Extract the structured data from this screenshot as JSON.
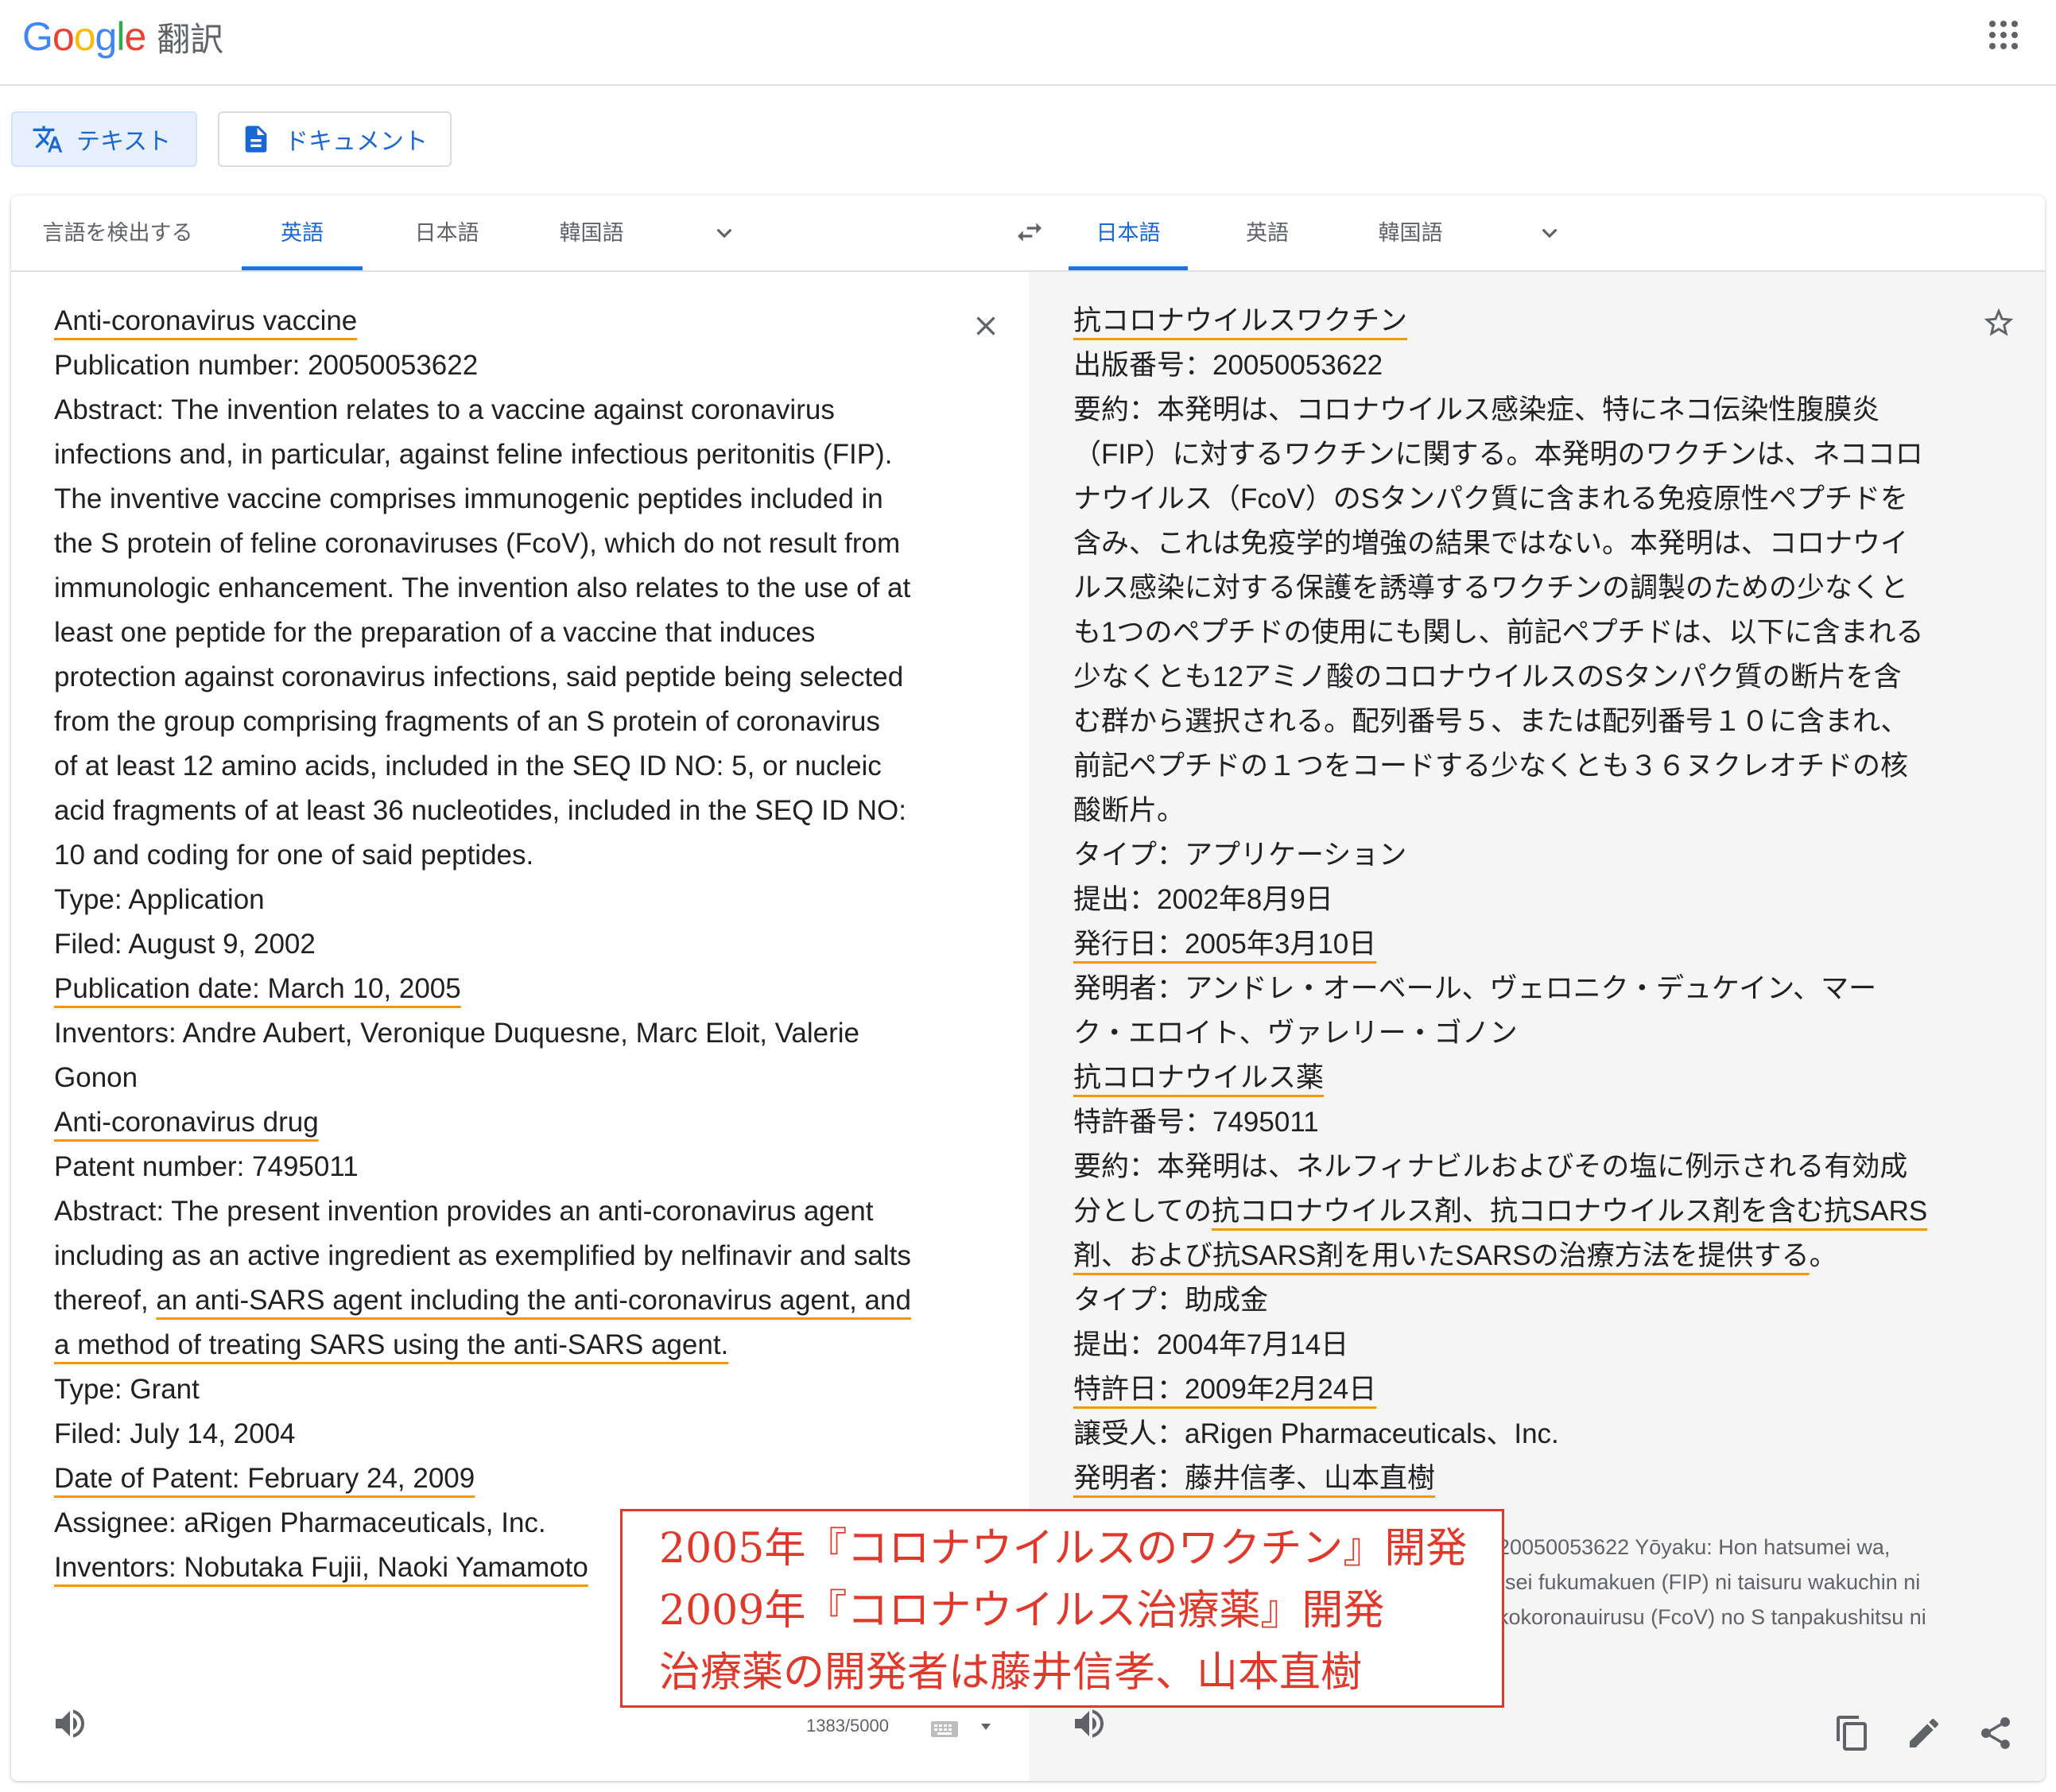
{
  "header": {
    "logo_text": "Google",
    "product": "翻訳",
    "apps_icon": "apps-grid-icon"
  },
  "modes": [
    {
      "label": "テキスト",
      "icon": "translate-icon",
      "active": true
    },
    {
      "label": "ドキュメント",
      "icon": "document-icon",
      "active": false
    }
  ],
  "source_tabs": [
    "言語を検出する",
    "英語",
    "日本語",
    "韓国語"
  ],
  "target_tabs": [
    "日本語",
    "英語",
    "韓国語"
  ],
  "colors": {
    "accent": "#1a73e8",
    "underline": "#f29900",
    "annotation": "#e0392b"
  },
  "source": {
    "lines": [
      "Anti-coronavirus vaccine",
      "Publication number: 20050053622",
      "Abstract: The invention relates to a vaccine against coronavirus",
      "infections and, in particular, against feline infectious peritonitis (FIP).",
      "The inventive vaccine comprises immunogenic peptides included in",
      "the S protein of feline coronaviruses (FcoV), which do not result from",
      "immunologic enhancement. The invention also relates to the use of at",
      "least one peptide for the preparation of a vaccine that induces",
      "protection against coronavirus infections, said peptide being selected",
      "from the group comprising fragments of an S protein of coronavirus",
      "of at least 12 amino acids, included in the SEQ ID NO: 5, or nucleic",
      "acid fragments of at least 36 nucleotides, included in the SEQ ID NO:",
      "10 and coding for one of said peptides.",
      "Type: Application",
      "Filed: August 9, 2002",
      "Publication date: March 10, 2005",
      "Inventors: Andre Aubert, Veronique Duquesne, Marc Eloit, Valerie",
      "Gonon",
      "Anti-coronavirus drug",
      "Patent number: 7495011",
      "Abstract: The present invention provides an anti-coronavirus agent",
      "including as an active ingredient as exemplified by nelfinavir and salts",
      "thereof, ",
      "an anti-SARS agent including the anti-coronavirus agent, and",
      "a method of treating SARS using the anti-SARS agent.",
      "Type: Grant",
      "Filed: July 14, 2004",
      "Date of Patent: February 24, 2009",
      "Assignee: aRigen Pharmaceuticals, Inc.",
      "Inventors: Nobutaka Fujii, Naoki Yamamoto"
    ],
    "char_count": "1383/5000"
  },
  "target": {
    "lines": [
      "抗コロナウイルスワクチン",
      "出版番号：20050053622",
      "要約：本発明は、コロナウイルス感染症、特にネコ伝染性腹膜炎",
      "（FIP）に対するワクチンに関する。本発明のワクチンは、ネココロ",
      "ナウイルス（FcoV）のSタンパク質に含まれる免疫原性ペプチドを",
      "含み、これは免疫学的増強の結果ではない。本発明は、コロナウイ",
      "ルス感染に対する保護を誘導するワクチンの調製のための少なくと",
      "も1つのペプチドの使用にも関し、前記ペプチドは、以下に含まれる",
      "少なくとも12アミノ酸のコロナウイルスのSタンパク質の断片を含",
      "む群から選択される。配列番号５、または配列番号１０に含まれ、",
      "前記ペプチドの１つをコードする少なくとも３６ヌクレオチドの核",
      "酸断片。",
      "タイプ：アプリケーション",
      "提出：2002年8月9日",
      "発行日：2005年3月10日",
      "発明者：アンドレ・オーベール、ヴェロニク・デュケイン、マー",
      "ク・エロイト、ヴァレリー・ゴノン",
      "抗コロナウイルス薬",
      "特許番号：7495011",
      "要約：本発明は、ネルフィナビルおよびその塩に例示される有効成",
      "分としての",
      "抗コロナウイルス剤、抗コロナウイルス剤を含む抗SARS",
      "剤、および抗SARS剤を用いたSARSの治療方法を提供する",
      "。",
      "タイプ：助成金",
      "提出：2004年7月14日",
      "特許日：2009年2月24日",
      "譲受人：aRigen Pharmaceuticals、Inc.",
      "発明者：藤井信孝、山本直樹"
    ],
    "romanization": [
      "20050053622 Yōyaku: Hon hatsumei wa,",
      "-sei fukumakuen (FIP) ni taisuru wakuchin ni",
      "kokoronauirusu (FcoV) no S tanpakushitsu ni"
    ]
  },
  "annotation": {
    "lines": [
      "2005年『コロナウイルスのワクチン』開発",
      "2009年『コロナウイルス治療薬』開発",
      "治療薬の開発者は藤井信孝、山本直樹"
    ]
  }
}
